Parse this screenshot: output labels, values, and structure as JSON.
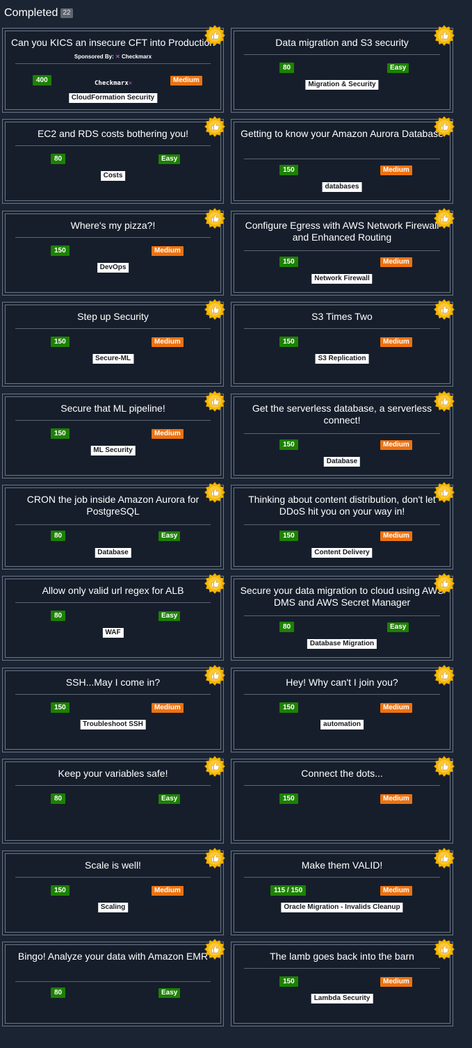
{
  "header": {
    "title": "Completed",
    "count": "22"
  },
  "sponsor": {
    "label": "Sponsored By:",
    "name": "Checkmarx",
    "logo_text": "Checkmarx"
  },
  "colors": {
    "background": "#1b2433",
    "points": "#1d8102",
    "easy": "#1d8102",
    "medium": "#ec7211",
    "badge": "#f5b800"
  },
  "challenges": [
    {
      "title": "Can you KICS an insecure CFT into Production",
      "points": "400",
      "difficulty": "Medium",
      "tag": "CloudFormation Security",
      "sponsored": true
    },
    {
      "title": "Data migration and S3 security",
      "points": "80",
      "difficulty": "Easy",
      "tag": "Migration & Security"
    },
    {
      "title": "EC2 and RDS costs bothering you!",
      "points": "80",
      "difficulty": "Easy",
      "tag": "Costs"
    },
    {
      "title": "Getting to know your Amazon Aurora Database",
      "points": "150",
      "difficulty": "Medium",
      "tag": "databases"
    },
    {
      "title": "Where's my pizza?!",
      "points": "150",
      "difficulty": "Medium",
      "tag": "DevOps"
    },
    {
      "title": "Configure Egress with AWS Network Firewall and Enhanced Routing",
      "points": "150",
      "difficulty": "Medium",
      "tag": "Network Firewall"
    },
    {
      "title": "Step up Security",
      "points": "150",
      "difficulty": "Medium",
      "tag": "Secure-ML"
    },
    {
      "title": "S3 Times Two",
      "points": "150",
      "difficulty": "Medium",
      "tag": "S3 Replication"
    },
    {
      "title": "Secure that ML pipeline!",
      "points": "150",
      "difficulty": "Medium",
      "tag": "ML Security"
    },
    {
      "title": "Get the serverless database, a serverless connect!",
      "points": "150",
      "difficulty": "Medium",
      "tag": "Database"
    },
    {
      "title": "CRON the job inside Amazon Aurora for PostgreSQL",
      "points": "80",
      "difficulty": "Easy",
      "tag": "Database"
    },
    {
      "title": "Thinking about content distribution, don't let DDoS hit you on your way in!",
      "points": "150",
      "difficulty": "Medium",
      "tag": "Content Delivery"
    },
    {
      "title": "Allow only valid url regex for ALB",
      "points": "80",
      "difficulty": "Easy",
      "tag": "WAF"
    },
    {
      "title": "Secure your data migration to cloud using AWS DMS and AWS Secret Manager",
      "points": "80",
      "difficulty": "Easy",
      "tag": "Database Migration"
    },
    {
      "title": "SSH...May I come in?",
      "points": "150",
      "difficulty": "Medium",
      "tag": "Troubleshoot SSH"
    },
    {
      "title": "Hey! Why can't I join you?",
      "points": "150",
      "difficulty": "Medium",
      "tag": "automation"
    },
    {
      "title": "Keep your variables safe!",
      "points": "80",
      "difficulty": "Easy",
      "tag": ""
    },
    {
      "title": "Connect the dots...",
      "points": "150",
      "difficulty": "Medium",
      "tag": ""
    },
    {
      "title": "Scale is well!",
      "points": "150",
      "difficulty": "Medium",
      "tag": "Scaling"
    },
    {
      "title": "Make them VALID!",
      "points": "115 / 150",
      "difficulty": "Medium",
      "tag": "Oracle Migration - Invalids Cleanup"
    },
    {
      "title": "Bingo! Analyze your data with Amazon EMR",
      "points": "80",
      "difficulty": "Easy",
      "tag": ""
    },
    {
      "title": "The lamb goes back into the barn",
      "points": "150",
      "difficulty": "Medium",
      "tag": "Lambda Security"
    }
  ]
}
